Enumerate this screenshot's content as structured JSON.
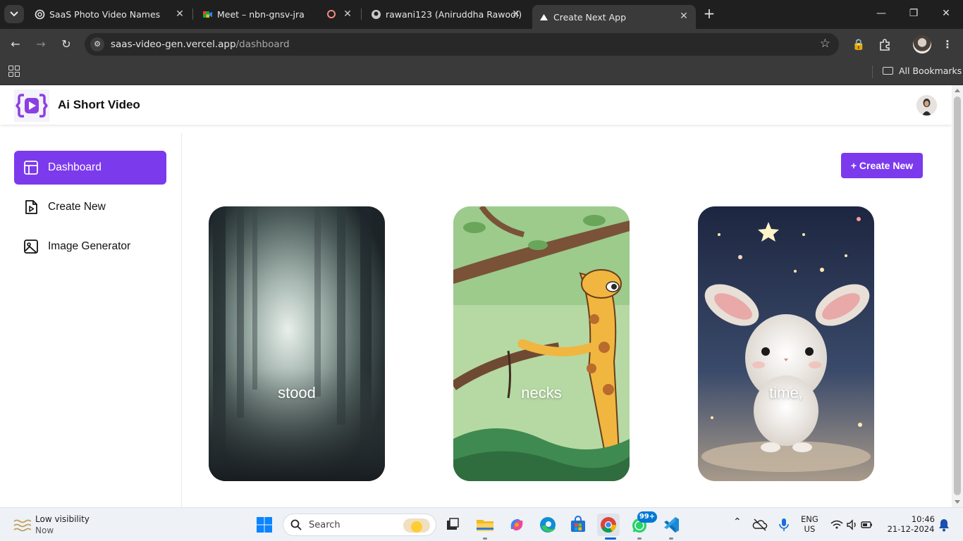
{
  "browser": {
    "tabs": [
      {
        "title": "SaaS Photo Video Names",
        "favicon": "chatgpt-icon"
      },
      {
        "title": "Meet – nbn-gnsv-jra",
        "favicon": "google-meet-icon"
      },
      {
        "title": "rawani123 (Aniruddha Rawool)",
        "favicon": "github-icon"
      },
      {
        "title": "Create Next App",
        "favicon": "vercel-icon"
      }
    ],
    "active_tab": 3,
    "url_host": "saas-video-gen.vercel.app",
    "url_path": "/dashboard",
    "bookmarks_label": "All Bookmarks"
  },
  "app": {
    "brand": "Ai Short Video",
    "accent_color": "#7c3aed",
    "sidebar": {
      "items": [
        {
          "label": "Dashboard",
          "icon": "layout-panel-icon",
          "active": true
        },
        {
          "label": "Create New",
          "icon": "file-video-icon",
          "active": false
        },
        {
          "label": "Image Generator",
          "icon": "image-icon",
          "active": false
        }
      ]
    },
    "create_button": "+ Create New",
    "videos": [
      {
        "caption": "stood",
        "thumbnail": "misty-forest"
      },
      {
        "caption": "necks",
        "thumbnail": "cartoon-giraffe"
      },
      {
        "caption": "time,",
        "thumbnail": "bunny-starry-night"
      }
    ]
  },
  "taskbar": {
    "weather_title": "Low visibility",
    "weather_sub": "Now",
    "search_placeholder": "Search",
    "whatsapp_badge": "99+",
    "lang_1": "ENG",
    "lang_2": "US",
    "time": "10:46",
    "date": "21-12-2024"
  }
}
